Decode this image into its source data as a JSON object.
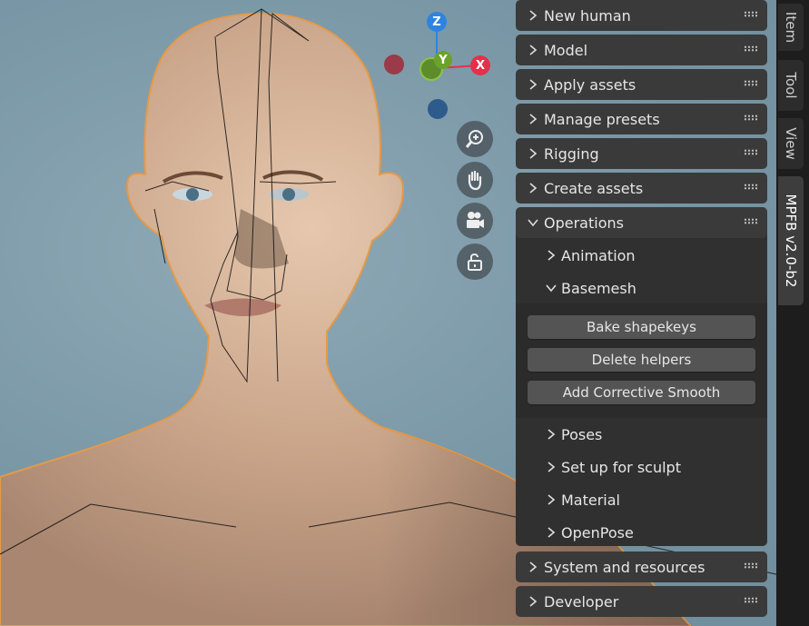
{
  "gizmo": {
    "z_label": "Z",
    "y_label": "Y",
    "x_label": "X",
    "colors": {
      "z": "#2f83e0",
      "y": "#6aa22b",
      "x": "#e5304c",
      "neg_x": "#9b3a48",
      "neg_z": "#2c5b8c"
    }
  },
  "navigation": [
    "zoom-icon",
    "hand-pan-icon",
    "camera-icon",
    "lock-icon"
  ],
  "panel": {
    "sections": {
      "new_human": "New human",
      "model": "Model",
      "apply_assets": "Apply assets",
      "manage_presets": "Manage presets",
      "rigging": "Rigging",
      "create_assets": "Create assets",
      "operations": "Operations",
      "system_resources": "System and resources",
      "developer": "Developer"
    },
    "operations": {
      "animation": "Animation",
      "basemesh": "Basemesh",
      "basemesh_buttons": {
        "bake_shapekeys": "Bake shapekeys",
        "delete_helpers": "Delete helpers",
        "add_corrective_smooth": "Add Corrective Smooth"
      },
      "poses": "Poses",
      "set_up_for_sculpt": "Set up for sculpt",
      "material": "Material",
      "openpose": "OpenPose"
    }
  },
  "sidebar_tabs": {
    "item": "Item",
    "tool": "Tool",
    "view": "View",
    "mpfb": "MPFB v2.0-b2"
  }
}
